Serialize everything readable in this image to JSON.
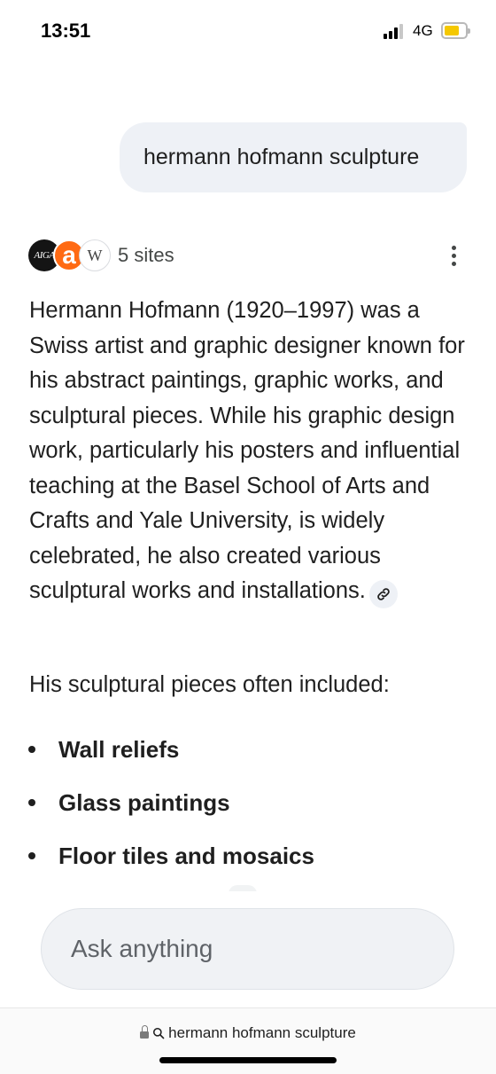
{
  "status_bar": {
    "time": "13:51",
    "network": "4G",
    "battery_level": 0.6,
    "battery_color": "#f5c800"
  },
  "query": {
    "text": "hermann hofmann sculpture"
  },
  "sources": {
    "favicons": [
      {
        "name": "aiga",
        "text": "AIGA"
      },
      {
        "name": "a-site",
        "text": "a",
        "color": "#ff6a13"
      },
      {
        "name": "wikipedia",
        "text": "W"
      }
    ],
    "count_label": "5 sites",
    "more_icon": "more-vertical-icon"
  },
  "answer": {
    "paragraph": "Hermann Hofmann (1920–1997) was a Swiss artist and graphic designer known for his abstract paintings, graphic works, and sculptural pieces. While his graphic design work, particularly his posters and influential teaching at the Basel School of Arts and Crafts and Yale University, is widely celebrated, he also created various sculptural works and installations.",
    "link_icon": "link-icon",
    "intro": "His sculptural pieces often included:",
    "bullets": [
      {
        "text": "Wall reliefs"
      },
      {
        "text": "Glass paintings"
      },
      {
        "text": "Floor tiles and mosaics"
      }
    ]
  },
  "ask": {
    "placeholder": "Ask anything"
  },
  "browser": {
    "url_text": "hermann hofmann sculpture",
    "lock_icon": "lock-icon",
    "search_icon": "search-icon"
  }
}
